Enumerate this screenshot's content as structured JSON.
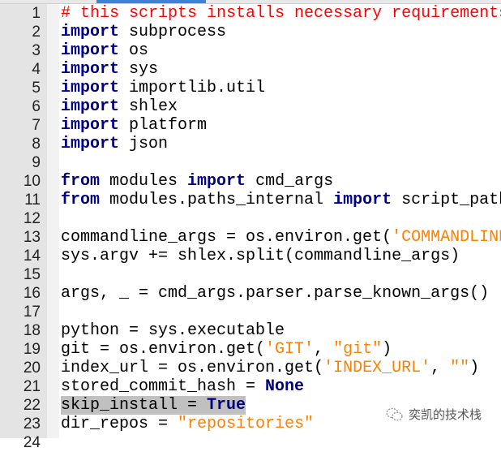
{
  "colors": {
    "keyword": "#000080",
    "comment": "#ff0000",
    "string": "#ff8000",
    "selection": "#c0c0c0",
    "gutter": "#e4e4e4",
    "tab_indicator": "#3c82d8"
  },
  "editor": {
    "selected_line": 22,
    "lines": [
      {
        "n": "1",
        "t": [
          [
            "cm",
            "# this scripts installs necessary requirements"
          ]
        ]
      },
      {
        "n": "2",
        "t": [
          [
            "kw",
            "import"
          ],
          [
            "",
            " subprocess"
          ]
        ]
      },
      {
        "n": "3",
        "t": [
          [
            "kw",
            "import"
          ],
          [
            "",
            " os"
          ]
        ]
      },
      {
        "n": "4",
        "t": [
          [
            "kw",
            "import"
          ],
          [
            "",
            " sys"
          ]
        ]
      },
      {
        "n": "5",
        "t": [
          [
            "kw",
            "import"
          ],
          [
            "",
            " importlib.util"
          ]
        ]
      },
      {
        "n": "6",
        "t": [
          [
            "kw",
            "import"
          ],
          [
            "",
            " shlex"
          ]
        ]
      },
      {
        "n": "7",
        "t": [
          [
            "kw",
            "import"
          ],
          [
            "",
            " platform"
          ]
        ]
      },
      {
        "n": "8",
        "t": [
          [
            "kw",
            "import"
          ],
          [
            "",
            " json"
          ]
        ]
      },
      {
        "n": "9",
        "t": []
      },
      {
        "n": "10",
        "t": [
          [
            "kw",
            "from"
          ],
          [
            "",
            " modules "
          ],
          [
            "kw",
            "import"
          ],
          [
            "",
            " cmd_args"
          ]
        ]
      },
      {
        "n": "11",
        "t": [
          [
            "kw",
            "from"
          ],
          [
            "",
            " modules.paths_internal "
          ],
          [
            "kw",
            "import"
          ],
          [
            "",
            " script_path"
          ]
        ]
      },
      {
        "n": "12",
        "t": []
      },
      {
        "n": "13",
        "t": [
          [
            "",
            "commandline_args = os.environ.get("
          ],
          [
            "st",
            "'COMMANDLINE"
          ]
        ]
      },
      {
        "n": "14",
        "t": [
          [
            "",
            "sys.argv += shlex.split(commandline_args)"
          ]
        ]
      },
      {
        "n": "15",
        "t": []
      },
      {
        "n": "16",
        "t": [
          [
            "",
            "args, _ = cmd_args.parser.parse_known_args()"
          ]
        ]
      },
      {
        "n": "17",
        "t": []
      },
      {
        "n": "18",
        "t": [
          [
            "",
            "python = sys.executable"
          ]
        ]
      },
      {
        "n": "19",
        "t": [
          [
            "",
            "git = os.environ.get("
          ],
          [
            "st",
            "'GIT'"
          ],
          [
            "",
            ", "
          ],
          [
            "st",
            "\"git\""
          ],
          [
            "",
            ")"
          ]
        ]
      },
      {
        "n": "20",
        "t": [
          [
            "",
            "index_url = os.environ.get("
          ],
          [
            "st",
            "'INDEX_URL'"
          ],
          [
            "",
            ", "
          ],
          [
            "st",
            "\"\""
          ],
          [
            "",
            ")"
          ]
        ]
      },
      {
        "n": "21",
        "t": [
          [
            "",
            "stored_commit_hash = "
          ],
          [
            "kw",
            "None"
          ]
        ]
      },
      {
        "n": "22",
        "t": [
          [
            "",
            "skip_install = "
          ],
          [
            "kw",
            "True"
          ]
        ]
      },
      {
        "n": "23",
        "t": [
          [
            "",
            "dir_repos = "
          ],
          [
            "st",
            "\"repositories\""
          ]
        ]
      },
      {
        "n": "24",
        "t": []
      }
    ]
  },
  "watermark": {
    "text": "奕凯的技术栈",
    "icon": "wechat-icon"
  }
}
